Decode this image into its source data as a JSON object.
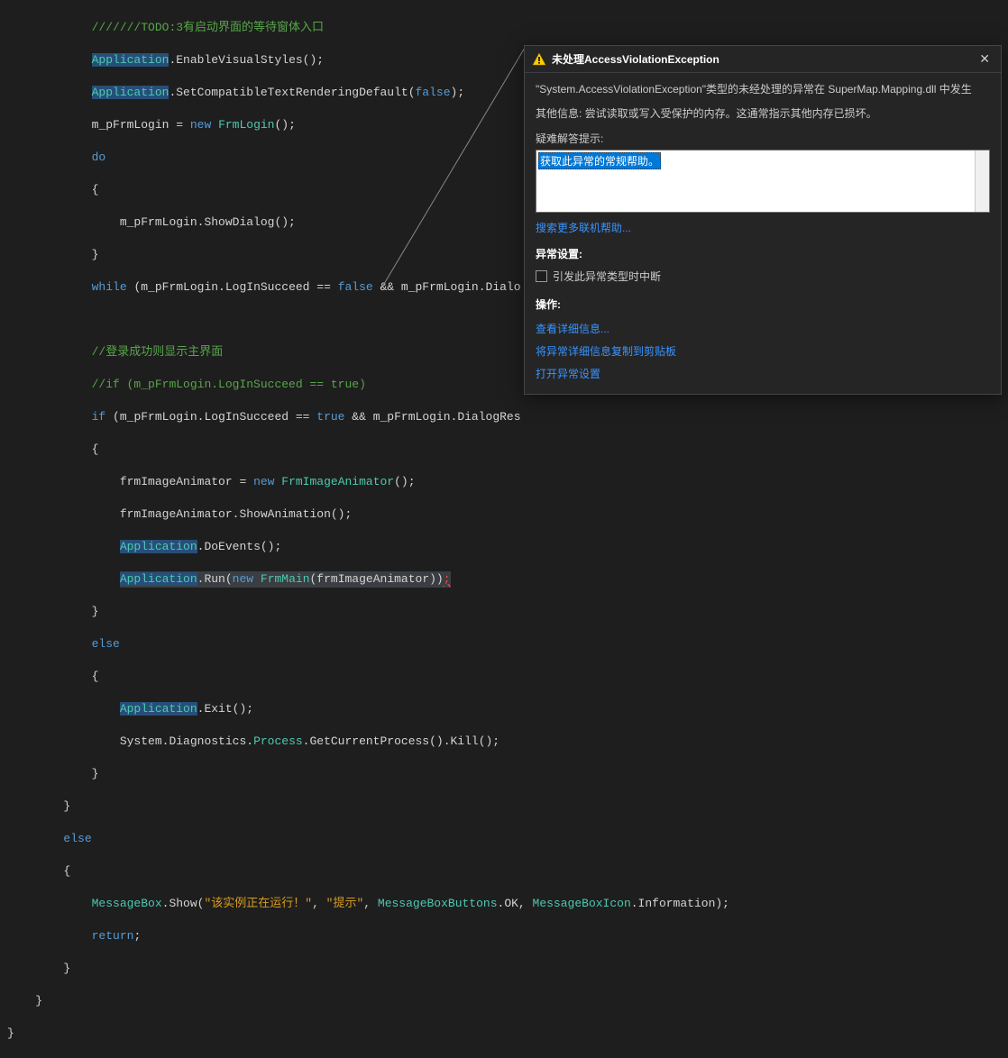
{
  "code": {
    "l1": "///////TODO:3有启动界面的等待窗体入口",
    "app": "Application",
    "enableVS": ".EnableVisualStyles();",
    "setCompat": ".SetCompatibleTextRenderingDefault(",
    "false": "false",
    "closeParen": ");",
    "mpfl_eq": "m_pFrmLogin = ",
    "new": "new",
    "sp": " ",
    "frmLogin": "FrmLogin",
    "unit": "();",
    "do": "do",
    "obrace": "{",
    "showDialog": "    m_pFrmLogin.ShowDialog();",
    "cbrace": "}",
    "while_pre": "while",
    "while_cond": " (m_pFrmLogin.LogInSucceed == ",
    "amp": " && m_pFrmLogin.Dialo",
    "comment2": "//登录成功则显示主界面",
    "comment3": "//if (m_pFrmLogin.LogInSucceed == true)",
    "if": "if",
    "if_cond": " (m_pFrmLogin.LogInSucceed == ",
    "true": "true",
    "if_cond2": " && m_pFrmLogin.DialogRes",
    "frmIA_assign": "    frmImageAnimator = ",
    "frmIA_type": "FrmImageAnimator",
    "showAnim": "    frmImageAnimator.ShowAnimation();",
    "doEvents": ".DoEvents();",
    "run": ".Run(",
    "frmMain": "FrmMain",
    "runArg": "(frmImageAnimator))",
    "semi": ";",
    "else": "else",
    "exit": ".Exit();",
    "sysDiag": "    System.Diagnostics.",
    "process": "Process",
    "getCP": ".GetCurrentProcess().Kill();",
    "msgBox": "MessageBox",
    "show": ".Show(",
    "str1": "\"该实例正在运行！\"",
    "comma": ", ",
    "str2": "\"提示\"",
    "mbb": "MessageBoxButtons",
    "ok": ".OK, ",
    "mbi": "MessageBoxIcon",
    "info": ".Information);",
    "return": "return",
    "semicolon": ";",
    "ind1": "    ",
    "ind2": "        ",
    "ind3": "            ",
    "ind4": "                ",
    "ind5": "                    "
  },
  "popup": {
    "title": "未处理AccessViolationException",
    "msg1": "\"System.AccessViolationException\"类型的未经处理的异常在 SuperMap.Mapping.dll 中发生",
    "msg2": "其他信息: 尝试读取或写入受保护的内存。这通常指示其他内存已损坏。",
    "hintLabel": "疑难解答提示:",
    "hintSelected": "获取此异常的常规帮助。",
    "searchLink": "搜索更多联机帮助...",
    "settingsTitle": "异常设置:",
    "checkbox1": "引发此异常类型时中断",
    "actionsTitle": "操作:",
    "action1": "查看详细信息...",
    "action2": "将异常详细信息复制到剪贴板",
    "action3": "打开异常设置"
  }
}
